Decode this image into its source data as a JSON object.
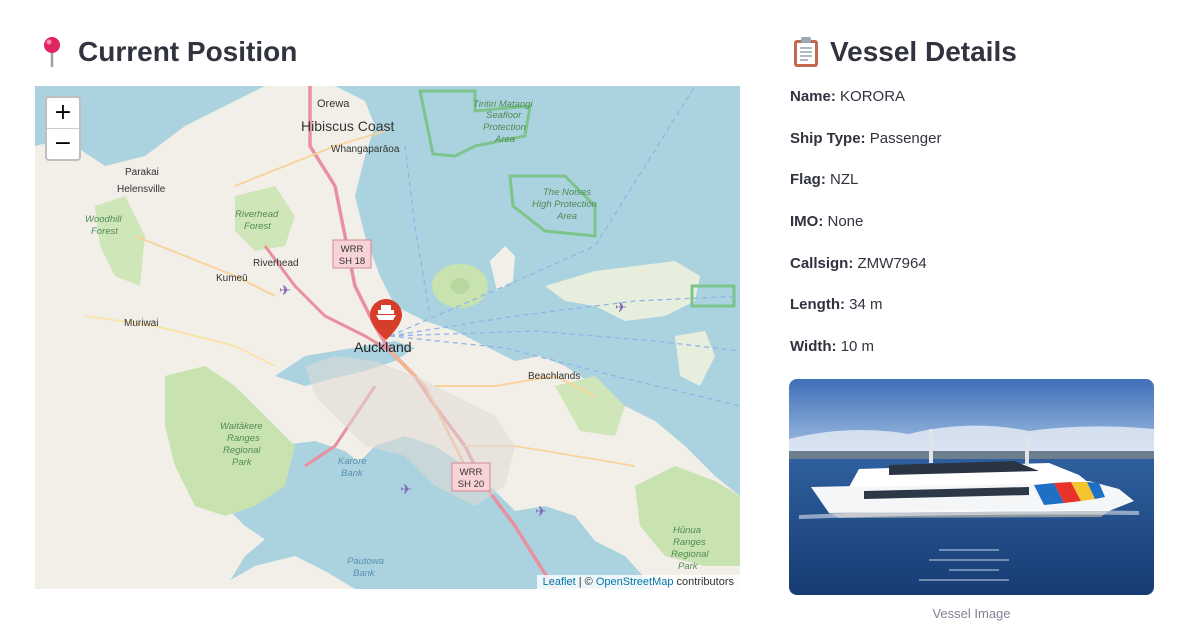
{
  "map_section": {
    "icon": "round-pushpin-icon",
    "title": "Current Position",
    "zoom_in": "+",
    "zoom_out": "−",
    "attribution": {
      "leaflet": "Leaflet",
      "separator": " | © ",
      "osm": "OpenStreetMap",
      "suffix": " contributors"
    },
    "labels": {
      "orewa": "Orewa",
      "hibiscus": "Hibiscus Coast",
      "whangaparaoa": "Whangaparāoa",
      "tiritiri1": "Tiritiri Matangi",
      "tiritiri2": "Seafloor",
      "tiritiri3": "Protection",
      "tiritiri4": "Area",
      "parakai": "Parakai",
      "helensville": "Helensville",
      "woodhill1": "Woodhill",
      "woodhill2": "Forest",
      "riverhead_forest1": "Riverhead",
      "riverhead_forest2": "Forest",
      "riverhead": "Riverhead",
      "kumeu": "Kumeū",
      "noises1": "The Noises",
      "noises2": "High Protection",
      "noises3": "Area",
      "muriwai": "Muriwai",
      "auckland": "Auckland",
      "beachlands": "Beachlands",
      "waitakere1": "Waitākere",
      "waitakere2": "Ranges",
      "waitakere3": "Regional",
      "waitakere4": "Park",
      "karore1": "Karore",
      "karore2": "Bank",
      "hunua1": "Hūnua",
      "hunua2": "Ranges",
      "hunua3": "Regional",
      "hunua4": "Park",
      "pautowa1": "Pautowa",
      "pautowa2": "Bank",
      "shield18_1": "WRR",
      "shield18_2": "SH 18",
      "shield20_1": "WRR",
      "shield20_2": "SH 20"
    },
    "marker_icon": "ship-marker-icon",
    "colors": {
      "water": "#aad3df",
      "land": "#f2efe9",
      "park": "#c8e3b0",
      "marker": "#d63e2a",
      "motorway": "#e990a0"
    }
  },
  "details_section": {
    "icon": "clipboard-icon",
    "title": "Vessel Details",
    "fields": [
      {
        "label": "Name:",
        "value": "KORORA"
      },
      {
        "label": "Ship Type:",
        "value": "Passenger"
      },
      {
        "label": "Flag:",
        "value": "NZL"
      },
      {
        "label": "IMO:",
        "value": "None"
      },
      {
        "label": "Callsign:",
        "value": "ZMW7964"
      },
      {
        "label": "Length:",
        "value": "34 m"
      },
      {
        "label": "Width:",
        "value": "10 m"
      }
    ],
    "image_caption": "Vessel Image"
  }
}
